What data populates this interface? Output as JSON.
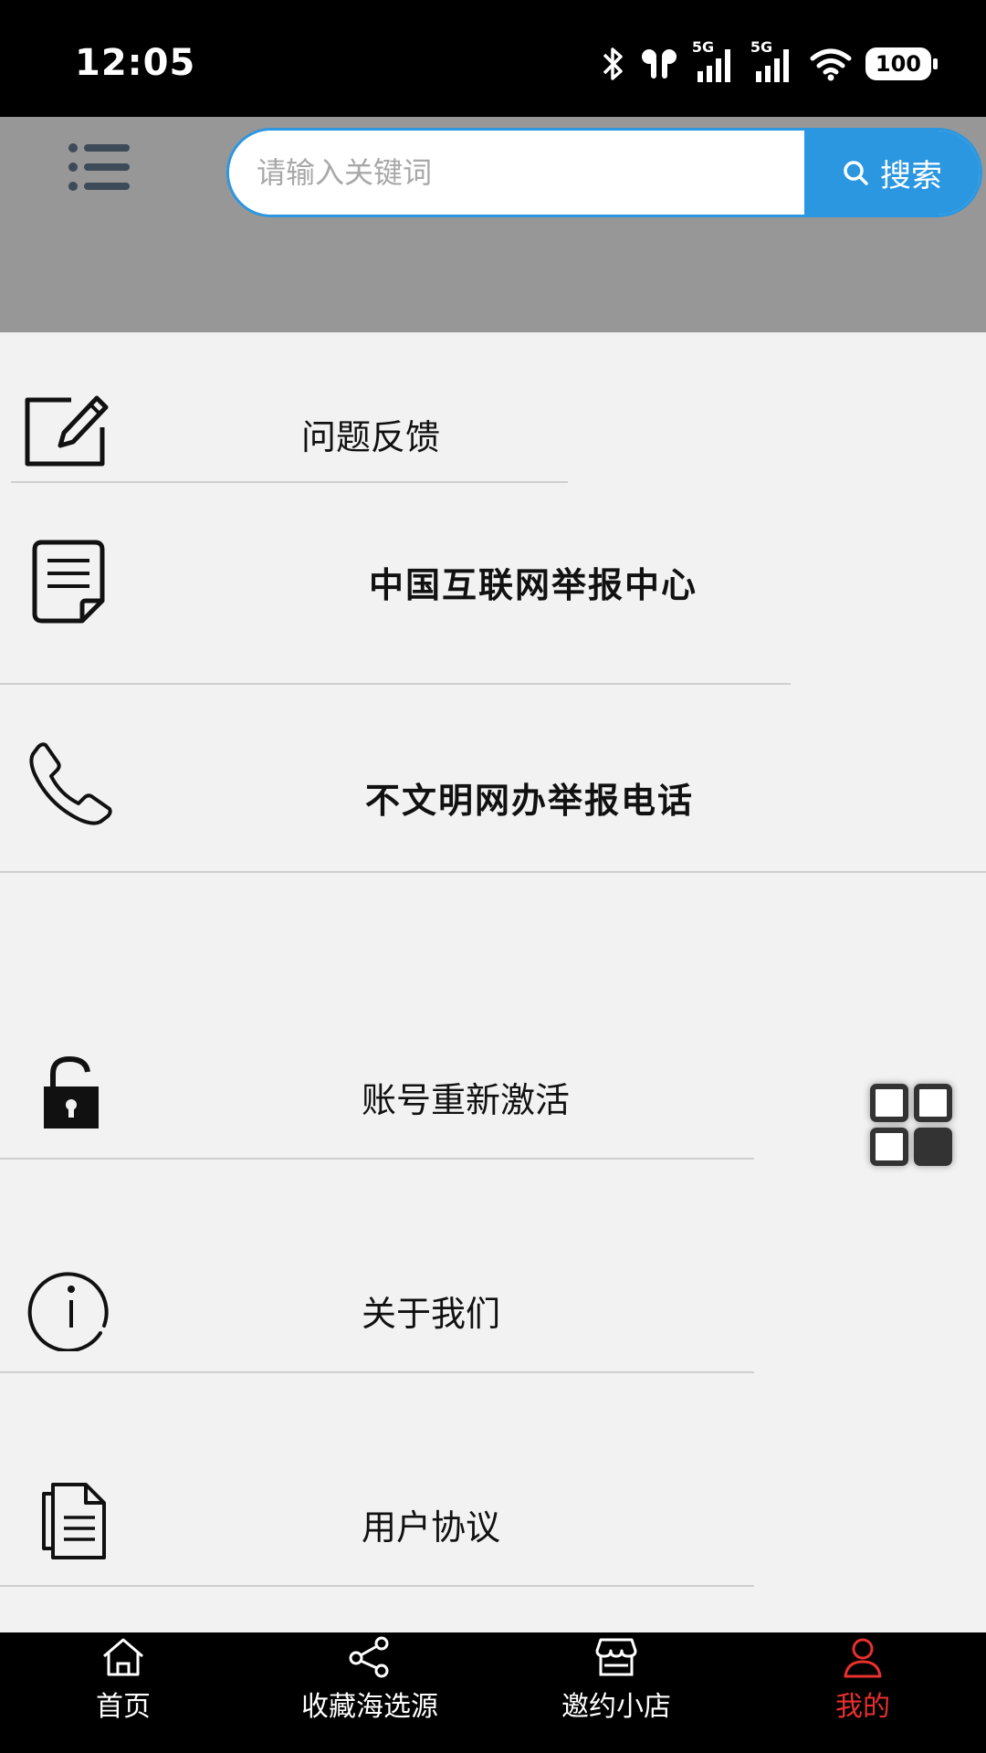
{
  "status_bar": {
    "time": "12:05",
    "network_1": "5G",
    "network_2": "5G",
    "battery": "100"
  },
  "header": {
    "search_placeholder": "请输入关键词",
    "search_button": "搜索"
  },
  "menu": {
    "card1": [
      {
        "label": "问题反馈",
        "icon": "edit-icon"
      },
      {
        "label": "中国互联网举报中心",
        "icon": "document-icon"
      },
      {
        "label": "不文明网办举报电话",
        "icon": "phone-icon"
      }
    ],
    "reactivate": {
      "label": "账号重新激活",
      "icon": "unlock-icon"
    },
    "about": {
      "label": "关于我们",
      "icon": "info-icon"
    },
    "agreement": {
      "label": "用户协议",
      "icon": "files-icon"
    }
  },
  "bottom_nav": [
    {
      "label": "首页",
      "icon": "home-icon",
      "active": false
    },
    {
      "label": "收藏海选源",
      "icon": "share-icon",
      "active": false
    },
    {
      "label": "邀约小店",
      "icon": "store-icon",
      "active": false
    },
    {
      "label": "我的",
      "icon": "user-icon",
      "active": true
    }
  ],
  "colors": {
    "accent": "#2a97e0",
    "active_tab": "#e8302e",
    "header_bg": "#979797",
    "card_bg": "#f2f2f2"
  }
}
